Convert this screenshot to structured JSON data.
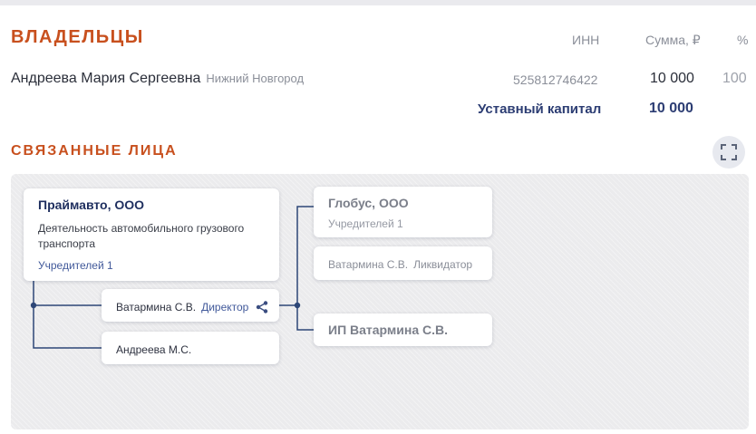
{
  "owners": {
    "title": "ВЛАДЕЛЬЦЫ",
    "columns": {
      "inn": "ИНН",
      "sum": "Сумма, ₽",
      "pct": "%"
    },
    "rows": [
      {
        "name": "Андреева Мария Сергеевна",
        "city": "Нижний Новгород",
        "inn": "525812746422",
        "sum": "10 000",
        "pct": "100"
      }
    ],
    "capital_label": "Уставный капитал",
    "capital_value": "10 000"
  },
  "related": {
    "title": "СВЯЗАННЫЕ ЛИЦА",
    "expand_icon": "expand-icon",
    "company": {
      "name": "Праймавто, ООО",
      "activity": "Деятельность автомобильного грузового транспорта",
      "founders": "Учредителей 1"
    },
    "persons": [
      {
        "name": "Ватармина С.В.",
        "role": "Директор",
        "icon": "share-icon"
      },
      {
        "name": "Андреева М.С.",
        "role": ""
      }
    ],
    "linked_company": {
      "name": "Глобус, ООО",
      "founders": "Учредителей 1",
      "person_name": "Ватармина С.В.",
      "person_role": "Ликвидатор"
    },
    "entrepreneur": {
      "name": "ИП Ватармина С.В."
    }
  },
  "colors": {
    "accent": "#c8501e",
    "navy": "#2c3d73",
    "line": "#2d4677"
  }
}
